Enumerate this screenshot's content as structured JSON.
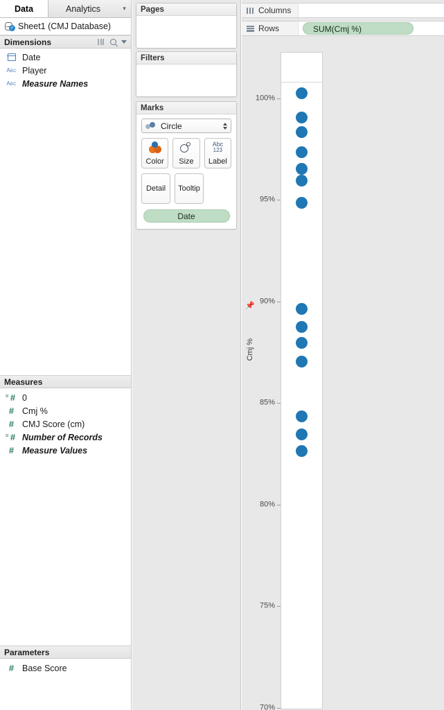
{
  "data_pane": {
    "tabs": [
      {
        "label": "Data",
        "active": true
      },
      {
        "label": "Analytics",
        "active": false
      }
    ],
    "sort_icon": "sort-icon",
    "datasource": {
      "label": "Sheet1 (CMJ Database)",
      "icon": "database-connected-icon"
    },
    "dimensions": {
      "header": "Dimensions",
      "header_icons": [
        "grid-icon",
        "search-icon",
        "chevron-down-icon"
      ],
      "fields": [
        {
          "label": "Date",
          "icon": "calendar-icon",
          "italic": false
        },
        {
          "label": "Player",
          "icon": "abc-icon",
          "italic": false
        },
        {
          "label": "Measure Names",
          "icon": "abc-icon",
          "italic": true
        }
      ]
    },
    "measures": {
      "header": "Measures",
      "fields": [
        {
          "label": "0",
          "icon": "hash-calc-icon",
          "italic": false
        },
        {
          "label": "Cmj %",
          "icon": "hash-icon",
          "italic": false
        },
        {
          "label": "CMJ Score (cm)",
          "icon": "hash-icon",
          "italic": false
        },
        {
          "label": "Number of Records",
          "icon": "hash-calc-icon",
          "italic": true
        },
        {
          "label": "Measure Values",
          "icon": "hash-icon",
          "italic": true
        }
      ]
    },
    "parameters": {
      "header": "Parameters",
      "fields": [
        {
          "label": "Base Score",
          "icon": "hash-icon",
          "italic": false
        }
      ]
    }
  },
  "cards": {
    "pages": {
      "title": "Pages"
    },
    "filters": {
      "title": "Filters"
    },
    "marks": {
      "title": "Marks",
      "mark_type": "Circle",
      "mark_type_icon": "circle-marks-icon",
      "buttons": [
        {
          "label": "Color",
          "icon": "color-icon"
        },
        {
          "label": "Size",
          "icon": "size-icon"
        },
        {
          "label": "Label",
          "icon": "label-icon",
          "icon_text_top": "Abc",
          "icon_text_bottom": "123"
        },
        {
          "label": "Detail",
          "icon": "detail-icon"
        },
        {
          "label": "Tooltip",
          "icon": "tooltip-icon"
        }
      ],
      "pills": [
        {
          "label": "Date"
        }
      ]
    }
  },
  "shelves": {
    "columns": {
      "label": "Columns",
      "icon": "columns-icon",
      "pills": []
    },
    "rows": {
      "label": "Rows",
      "icon": "rows-icon",
      "pills": [
        {
          "label": "SUM(Cmj %)"
        }
      ]
    }
  },
  "view": {
    "axis_title": "Cmj %",
    "pin_icon": "pin-icon",
    "mark_color": "#1f77b4"
  },
  "chart_data": {
    "type": "scatter",
    "title": "",
    "xlabel": "",
    "ylabel": "Cmj %",
    "ylim": [
      70,
      100.8
    ],
    "ytick_labels": [
      "100%",
      "95%",
      "90%",
      "85%",
      "80%",
      "75%",
      "70%"
    ],
    "yticks": [
      100,
      95,
      90,
      85,
      80,
      75,
      70
    ],
    "grid": false,
    "legend": "none",
    "x_single_category": true,
    "series": [
      {
        "name": "SUM(Cmj %)",
        "color": "#1f77b4",
        "values": [
          100.3,
          99.1,
          98.4,
          97.4,
          96.6,
          96.0,
          94.9,
          89.7,
          88.8,
          88.0,
          87.1,
          84.4,
          83.5,
          82.7
        ]
      }
    ]
  }
}
